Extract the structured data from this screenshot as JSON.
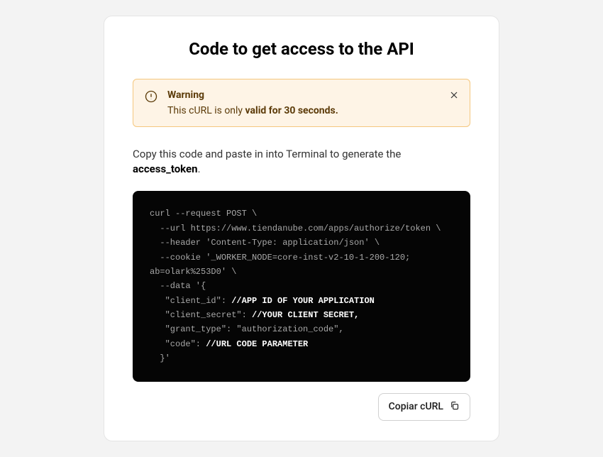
{
  "title": "Code to get access to the API",
  "alert": {
    "title": "Warning",
    "text_prefix": "This cURL is only ",
    "text_bold": "valid for 30 seconds."
  },
  "instruction": {
    "text_prefix": "Copy this code and paste in into Terminal to generate the ",
    "text_bold": "access_token",
    "text_suffix": "."
  },
  "code": {
    "line1": "curl --request POST \\",
    "line2": "  --url https://www.tiendanube.com/apps/authorize/token \\",
    "line3": "  --header 'Content-Type: application/json' \\",
    "line4_a": "  --cookie '_WORKER_NODE=core-inst-v2-10-1-200-120;",
    "line4_b": "ab=olark%253D0' \\",
    "line5": "  --data '{",
    "line6_a": "   \"client_id\": ",
    "line6_b": "//APP ID OF YOUR APPLICATION",
    "line7_a": "   \"client_secret\": ",
    "line7_b": "//YOUR CLIENT SECRET,",
    "line8": "   \"grant_type\": \"authorization_code\",",
    "line9_a": "   \"code\": ",
    "line9_b": "//URL CODE PARAMETER",
    "line10": "  }'"
  },
  "button": {
    "copy_label": "Copiar cURL"
  }
}
